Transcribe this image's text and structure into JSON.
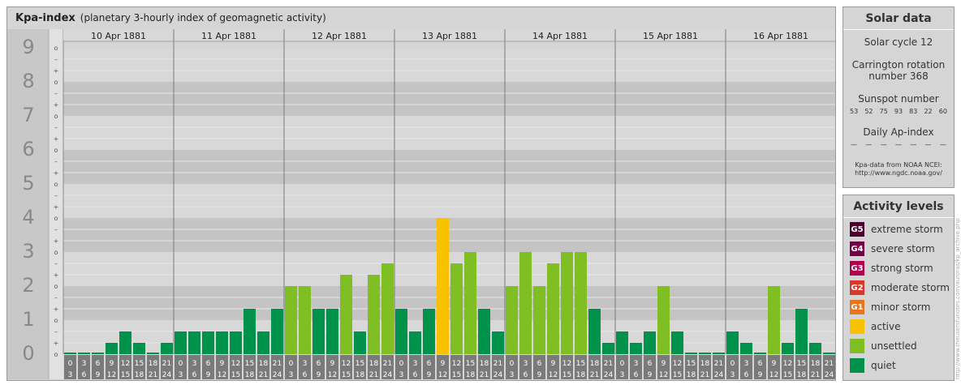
{
  "title": "Kpa-index",
  "subtitle": "(planetary 3-hourly index of geomagnetic activity)",
  "colors": {
    "quiet": "#00914a",
    "unsettled": "#7fbf24",
    "active": "#f9c201",
    "minor": "#e6751e",
    "moderate": "#d6382b",
    "strong": "#b0004e",
    "severe": "#720045",
    "extreme": "#4a0030"
  },
  "solar": {
    "title": "Solar data",
    "cycle": "Solar cycle 12",
    "carrington_line1": "Carrington rotation",
    "carrington_line2": "number 368",
    "sunspot_label": "Sunspot number",
    "sunspots": [
      "53",
      "52",
      "75",
      "93",
      "83",
      "22",
      "60"
    ],
    "ap_label": "Daily Ap-index",
    "ap_values": [
      "—",
      "—",
      "—",
      "—",
      "—",
      "—",
      "—"
    ],
    "source_line1": "Kpa-data from NOAA NCEI:",
    "source_line2": "http://www.ngdc.noaa.gov/"
  },
  "legend": {
    "title": "Activity levels",
    "items": [
      {
        "badge": "G5",
        "label": "extreme storm",
        "color": "#4a0030"
      },
      {
        "badge": "G4",
        "label": "severe storm",
        "color": "#720045"
      },
      {
        "badge": "G3",
        "label": "strong storm",
        "color": "#b0004e"
      },
      {
        "badge": "G2",
        "label": "moderate storm",
        "color": "#d6382b"
      },
      {
        "badge": "G1",
        "label": "minor storm",
        "color": "#e6751e"
      },
      {
        "badge": "",
        "label": "active",
        "color": "#f9c201"
      },
      {
        "badge": "",
        "label": "unsettled",
        "color": "#7fbf24"
      },
      {
        "badge": "",
        "label": "quiet",
        "color": "#00914a"
      }
    ]
  },
  "credit": "http://www.theusersfunotes.com/auroras/kp_archive.php",
  "chart_data": {
    "type": "bar",
    "title": "Kpa-index",
    "subtitle": "(planetary 3-hourly index of geomagnetic activity)",
    "ylim": [
      0,
      9
    ],
    "y_ticks": [
      "0",
      "1",
      "2",
      "3",
      "4",
      "5",
      "6",
      "7",
      "8",
      "9"
    ],
    "sub_ticks": [
      "–",
      "o",
      "+"
    ],
    "days": [
      "10 Apr 1881",
      "11 Apr 1881",
      "12 Apr 1881",
      "13 Apr 1881",
      "14 Apr 1881",
      "15 Apr 1881",
      "16 Apr 1881"
    ],
    "interval_top": [
      "0",
      "3",
      "6",
      "9",
      "12",
      "15",
      "18",
      "21"
    ],
    "interval_bottom": [
      "3",
      "6",
      "9",
      "12",
      "15",
      "18",
      "21",
      "24"
    ],
    "values": [
      [
        0,
        0,
        0,
        0.333,
        0.667,
        0.333,
        0,
        0.333
      ],
      [
        0.667,
        0.667,
        0.667,
        0.667,
        0.667,
        1.333,
        0.667,
        1.333
      ],
      [
        2,
        2,
        1.333,
        1.333,
        2.333,
        0.667,
        2.333,
        2.667
      ],
      [
        1.333,
        0.667,
        1.333,
        4,
        2.667,
        3,
        1.333,
        0.667
      ],
      [
        2,
        3,
        2,
        2.667,
        3,
        3,
        1.333,
        0.333
      ],
      [
        0.667,
        0.333,
        0.667,
        2,
        0.667,
        0,
        0,
        0
      ],
      [
        0.667,
        0.333,
        0,
        2,
        0.333,
        1.333,
        0.333,
        0
      ]
    ]
  }
}
